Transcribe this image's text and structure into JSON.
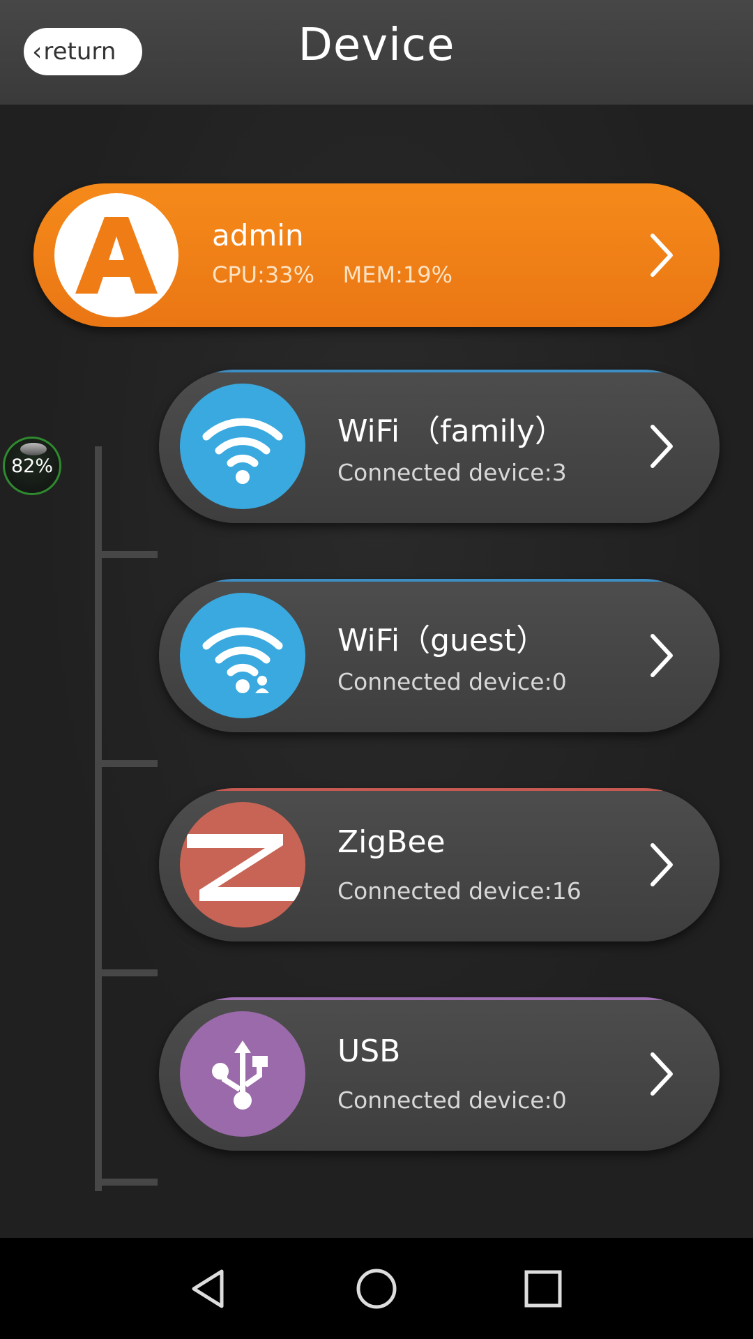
{
  "header": {
    "back_label": "return",
    "title": "Device"
  },
  "admin": {
    "avatar_letter": "A",
    "name": "admin",
    "stats": "CPU:33%    MEM:19%"
  },
  "battery": {
    "label": "82%"
  },
  "devices": [
    {
      "name": "WiFi （family）",
      "count": "Connected device:3",
      "icon": "wifi-icon",
      "color": "#3aa9df",
      "accent": "#3d8ec4"
    },
    {
      "name": "WiFi（guest）",
      "count": "Connected device:0",
      "icon": "wifi-guest-icon",
      "color": "#3aa9df",
      "accent": "#3d8ec4"
    },
    {
      "name": "ZigBee",
      "count": "Connected device:16",
      "icon": "zigbee-icon",
      "color": "#c86455",
      "accent": "#c65a52"
    },
    {
      "name": "USB",
      "count": "Connected device:0",
      "icon": "usb-icon",
      "color": "#9b6aaa",
      "accent": "#a06fb4"
    }
  ],
  "colors": {
    "admin": "#f07c16",
    "background": "#202020",
    "header": "#404040"
  }
}
